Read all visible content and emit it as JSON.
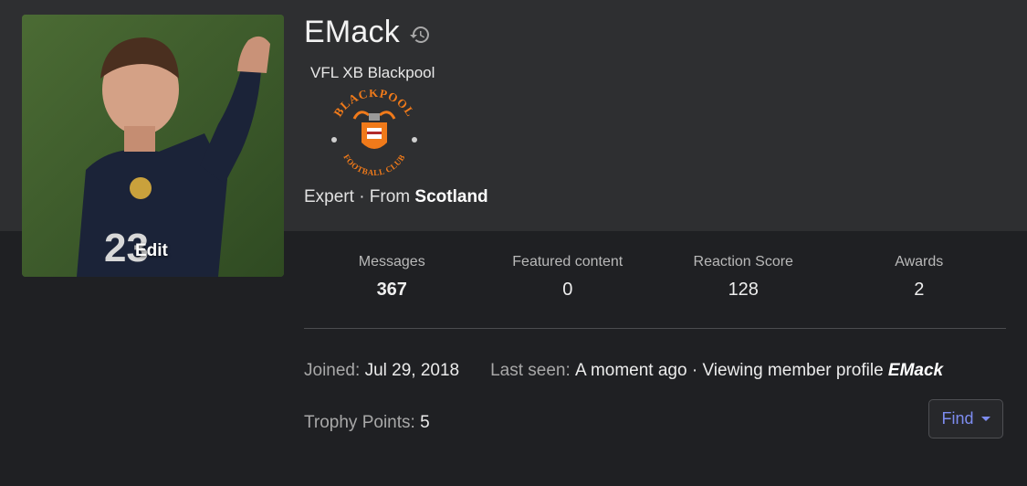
{
  "profile": {
    "username": "EMack",
    "team": "VFL XB Blackpool",
    "rank": "Expert",
    "from_prefix": " · From ",
    "location": "Scotland",
    "avatar_edit_label": "Edit",
    "crest_text_top": "BLACKPOOL",
    "crest_text_bottom": "FOOTBALL CLUB",
    "history_icon": "history-icon"
  },
  "stats": [
    {
      "label": "Messages",
      "value": "367"
    },
    {
      "label": "Featured content",
      "value": "0"
    },
    {
      "label": "Reaction Score",
      "value": "128"
    },
    {
      "label": "Awards",
      "value": "2"
    }
  ],
  "info": {
    "joined_label": "Joined:",
    "joined_value": "Jul 29, 2018",
    "last_seen_label": "Last seen:",
    "last_seen_value": "A moment ago · Viewing member profile",
    "viewing_name": "EMack",
    "trophy_label": "Trophy Points:",
    "trophy_value": "5"
  },
  "actions": {
    "find_label": "Find"
  },
  "colors": {
    "accent": "#7d8cf0",
    "crest_orange": "#f07a1a",
    "banner": "#2e2f31",
    "page": "#1f2023"
  }
}
